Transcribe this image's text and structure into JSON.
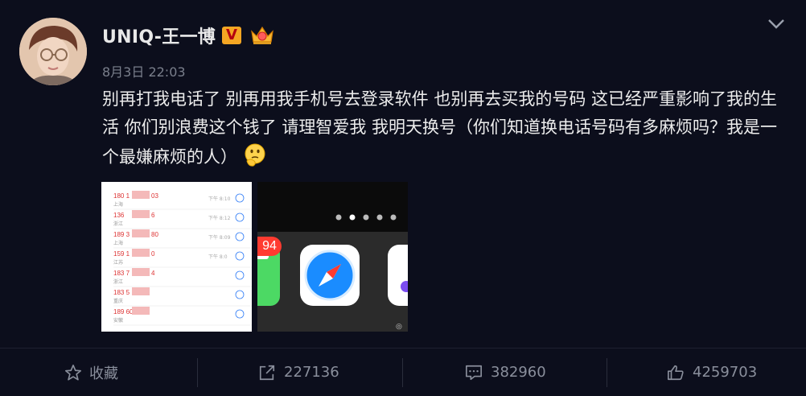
{
  "post": {
    "username": "UNIQ-王一博",
    "verified_badge": "V",
    "time": "8月3日 22:03",
    "text": "别再打我电话了 别再用我手机号去登录软件 也别再去买我的号码 这已经严重影响了我的生活 你们别浪费这个钱了 请理智爱我 我明天换号（你们知道换电话号码有多麻烦吗？我是一个最嫌麻烦的人）",
    "emoji": "thinking-face-emoji"
  },
  "icons": {
    "crown": "crown-icon",
    "menu": "chevron-down-icon",
    "favorite": "star-icon",
    "repost": "share-icon",
    "comment": "comment-icon",
    "like": "thumbs-up-icon"
  },
  "images": {
    "call_log": [
      {
        "number": "180 1",
        "suffix": "03",
        "location": "上海",
        "time": "下午 8:10"
      },
      {
        "number": "136",
        "suffix": "6",
        "location": "浙江",
        "time": "下午 8:12"
      },
      {
        "number": "189 3",
        "suffix": "80",
        "location": "上海",
        "time": "下午 8:09"
      },
      {
        "number": "159 1",
        "suffix": "0",
        "location": "江苏",
        "time": "下午 8:0"
      },
      {
        "number": "183 7",
        "suffix": "4",
        "location": "浙江",
        "time": ""
      },
      {
        "number": "183 5",
        "suffix": "",
        "location": "重庆",
        "time": ""
      },
      {
        "number": "189 60",
        "suffix": "",
        "location": "安徽",
        "time": ""
      }
    ],
    "badge_count": "94",
    "watermark": "微"
  },
  "actions": {
    "favorite_label": "收藏",
    "repost_count": "227136",
    "comment_count": "382960",
    "like_count": "4259703"
  },
  "colors": {
    "background": "#0c0e1c",
    "badge": "#f5a623",
    "notification": "#ff3b30"
  }
}
